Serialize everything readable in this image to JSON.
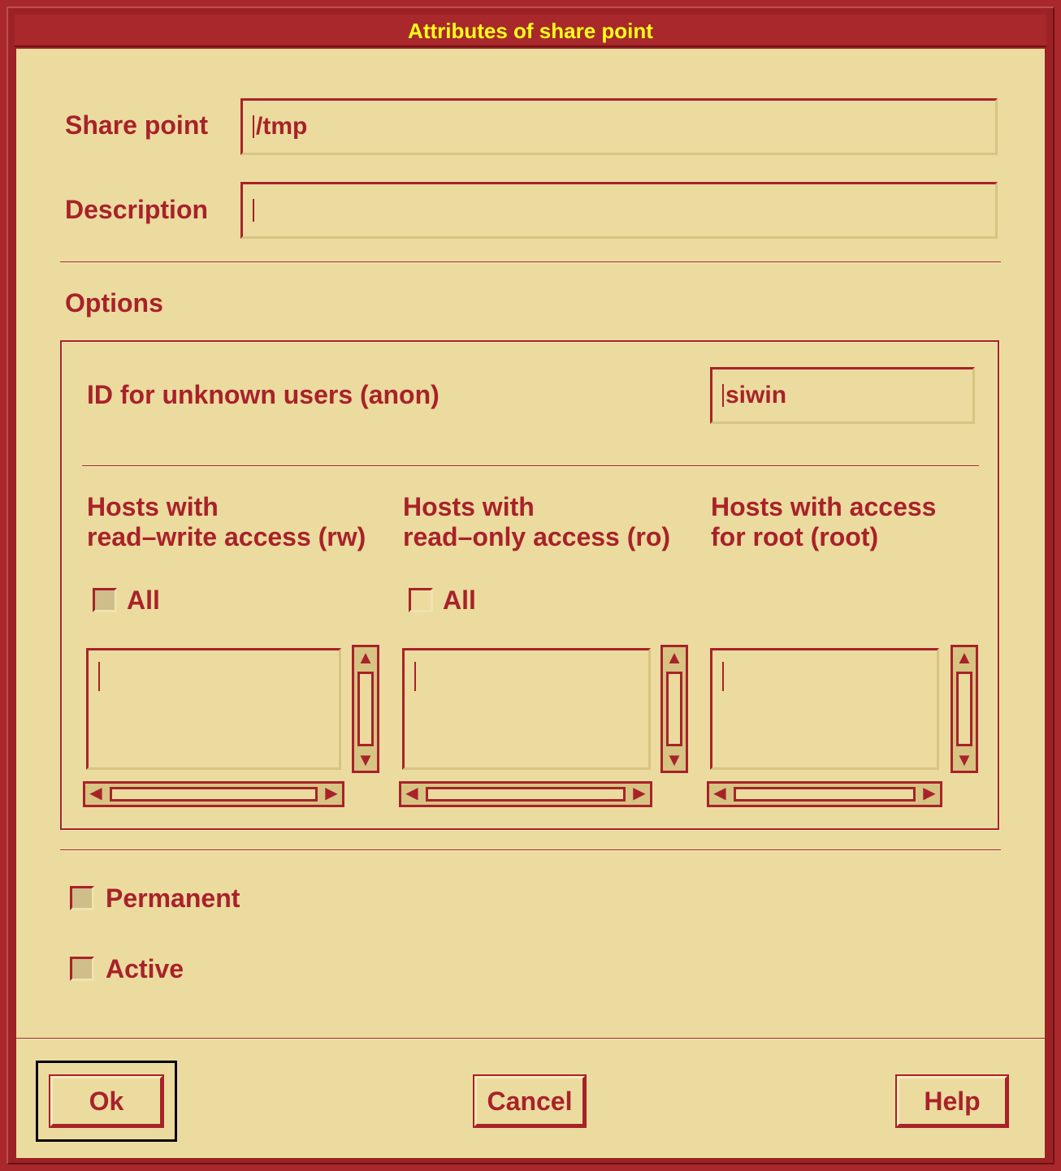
{
  "window": {
    "title": "Attributes of share point"
  },
  "form": {
    "share_point_label": "Share point",
    "share_point_value": "/tmp",
    "description_label": "Description",
    "description_value": "",
    "options_label": "Options"
  },
  "options": {
    "anon_label": "ID for unknown users (anon)",
    "anon_value": "siwin",
    "columns": [
      {
        "line1": "Hosts with",
        "line2": "read–write access (rw)",
        "all_label": "All",
        "all_checked": true
      },
      {
        "line1": "Hosts with",
        "line2": "read–only access (ro)",
        "all_label": "All",
        "all_checked": false
      },
      {
        "line1": "Hosts with access",
        "line2": "for root (root)"
      }
    ]
  },
  "flags": {
    "permanent_label": "Permanent",
    "permanent_checked": true,
    "active_label": "Active",
    "active_checked": true
  },
  "buttons": {
    "ok": "Ok",
    "cancel": "Cancel",
    "help": "Help"
  },
  "icons": {
    "scroll_up": "triangle-up-icon",
    "scroll_down": "triangle-down-icon",
    "scroll_left": "triangle-left-icon",
    "scroll_right": "triangle-right-icon"
  },
  "colors": {
    "background": "#ebdb9f",
    "accent": "#a8222a",
    "title_text": "#ffff1c",
    "frame": "#a8282b"
  }
}
